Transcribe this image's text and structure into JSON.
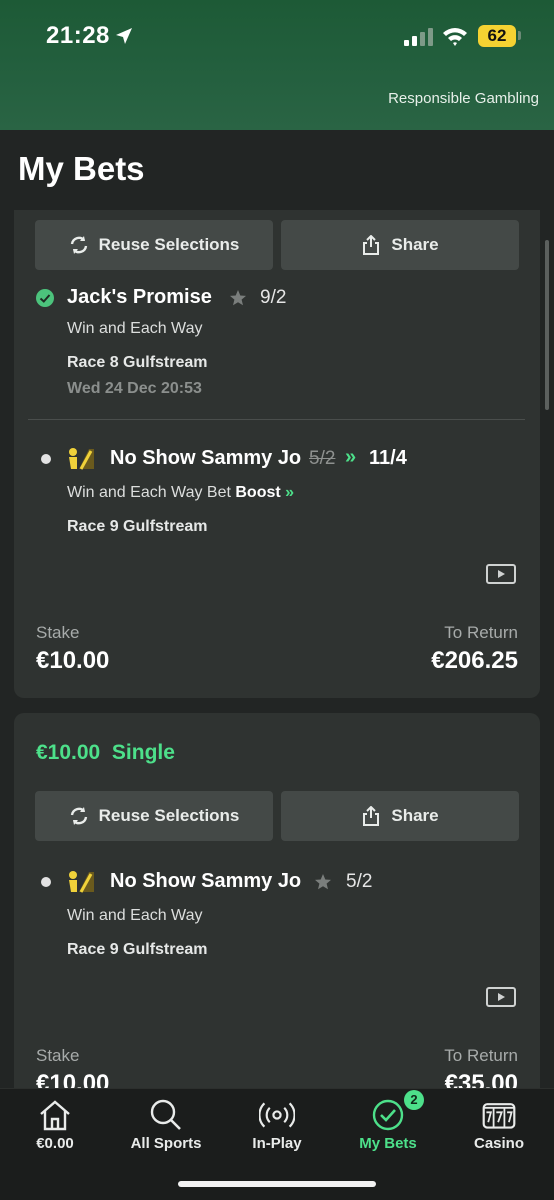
{
  "status_bar": {
    "time": "21:28",
    "battery": "62"
  },
  "header": {
    "responsible_gambling": "Responsible Gambling"
  },
  "page": {
    "title": "My Bets"
  },
  "bet1": {
    "reuse_label": "Reuse Selections",
    "share_label": "Share",
    "selection1": {
      "horse": "Jack's Promise",
      "odds": "9/2",
      "market": "Win and Each Way",
      "race": "Race 8 Gulfstream",
      "date": "Wed 24 Dec 20:53"
    },
    "selection2": {
      "horse": "No Show Sammy Jo",
      "old_odds": "5/2",
      "boost_arrows": "»",
      "new_odds": "11/4",
      "market_prefix": "Win and Each Way Bet",
      "market_boost": "Boost",
      "race": "Race 9 Gulfstream"
    },
    "stake_label": "Stake",
    "stake": "€10.00",
    "return_label": "To Return",
    "return": "€206.25"
  },
  "bet2": {
    "amount": "€10.00",
    "type": "Single",
    "reuse_label": "Reuse Selections",
    "share_label": "Share",
    "selection": {
      "horse": "No Show Sammy Jo",
      "odds": "5/2",
      "market": "Win and Each Way",
      "race": "Race 9 Gulfstream"
    },
    "stake_label": "Stake",
    "stake": "€10.00",
    "return_label": "To Return",
    "return": "€35.00"
  },
  "nav": {
    "balance": "€0.00",
    "all_sports": "All Sports",
    "in_play": "In-Play",
    "my_bets": "My Bets",
    "my_bets_badge": "2",
    "casino": "Casino"
  },
  "colors": {
    "accent": "#4de08a",
    "header_green": "#24603f",
    "card": "#2f3331",
    "battery": "#f5d232"
  }
}
